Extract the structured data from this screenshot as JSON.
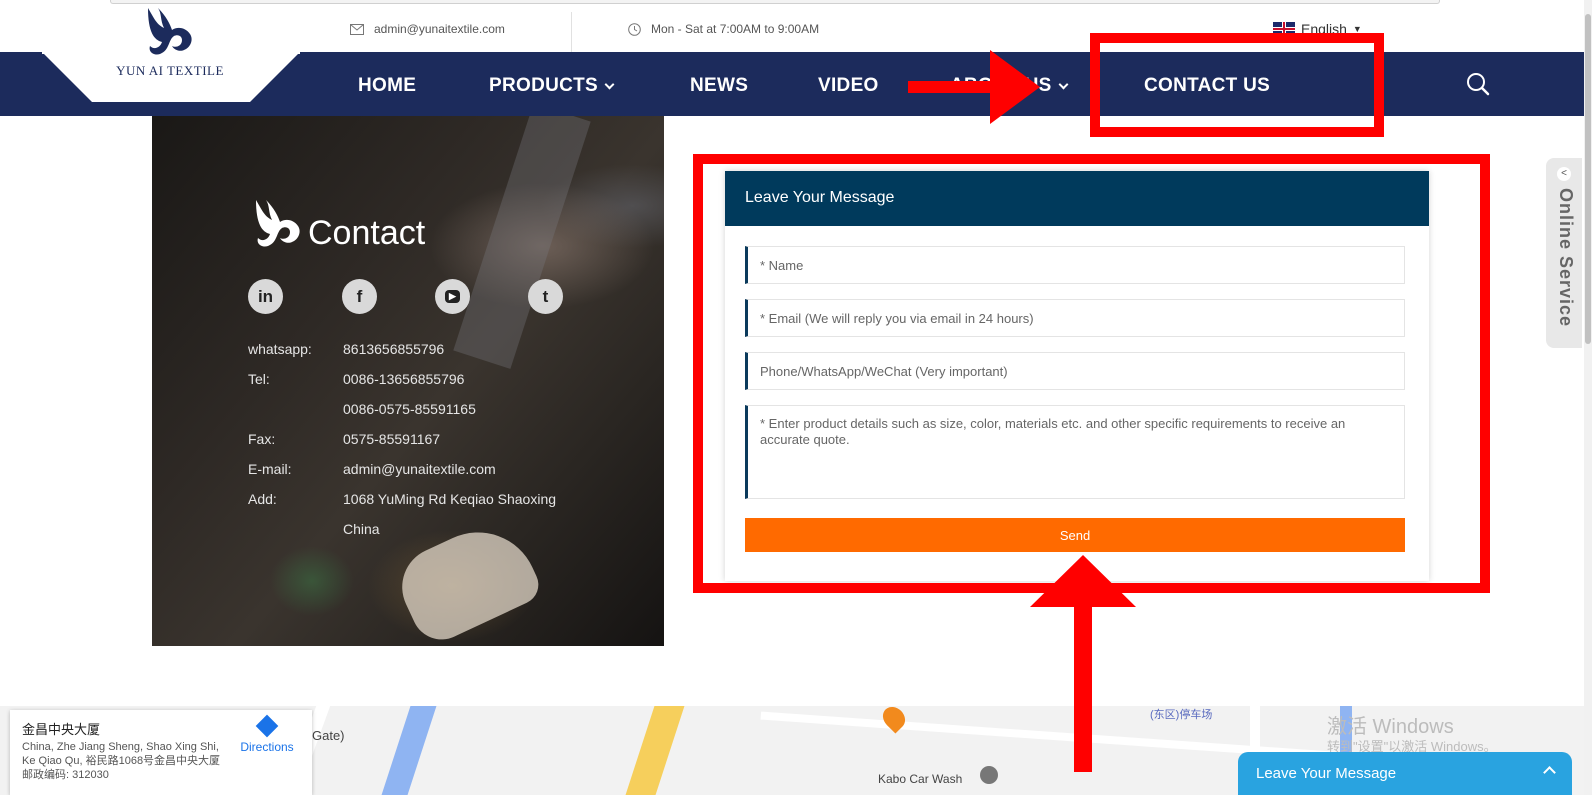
{
  "topbar": {
    "email": "admin@yunaitextile.com",
    "hours": "Mon - Sat at 7:00AM to 9:00AM",
    "language": "English"
  },
  "brand": {
    "name": "YUN AI TEXTILE"
  },
  "nav": {
    "home": "HOME",
    "products": "PRODUCTS",
    "news": "NEWS",
    "video": "VIDEO",
    "about": "ABOUT US",
    "contact": "CONTACT US"
  },
  "contact": {
    "title": "Contact",
    "social": [
      "in",
      "f",
      "▶",
      "t"
    ],
    "rows": [
      {
        "label": "whatsapp:",
        "value": "8613656855796"
      },
      {
        "label": "Tel:",
        "value": "0086-13656855796"
      },
      {
        "label": "",
        "value": "0086-0575-85591165"
      },
      {
        "label": "Fax:",
        "value": "0575-85591167"
      },
      {
        "label": "E-mail:",
        "value": "admin@yunaitextile.com"
      },
      {
        "label": "Add:",
        "value": "1068 YuMing Rd Keqiao Shaoxing"
      },
      {
        "label": "",
        "value": "China"
      }
    ]
  },
  "form": {
    "title": "Leave Your Message",
    "name_placeholder": "* Name",
    "email_placeholder": "* Email (We will reply you via email in 24 hours)",
    "phone_placeholder": "Phone/WhatsApp/WeChat (Very important)",
    "details_placeholder": "* Enter product details such as size, color, materials etc. and other specific requirements to receive an accurate quote.",
    "send_label": "Send"
  },
  "map": {
    "place_name": "金昌中央大厦",
    "address": "China, Zhe Jiang Sheng, Shao Xing Shi, Ke Qiao Qu, 裕民路1068号金昌中央大厦 邮政编码: 312030",
    "directions": "Directions",
    "label_gate": "Gate)",
    "label_carwash": "Kabo Car Wash",
    "label_parking": "(东区)停车场"
  },
  "windows": {
    "activate_title": "激活 Windows",
    "activate_sub": "转到\"设置\"以激活 Windows。"
  },
  "widgets": {
    "online_service": "Online Service",
    "leave_message": "Leave Your Message"
  }
}
